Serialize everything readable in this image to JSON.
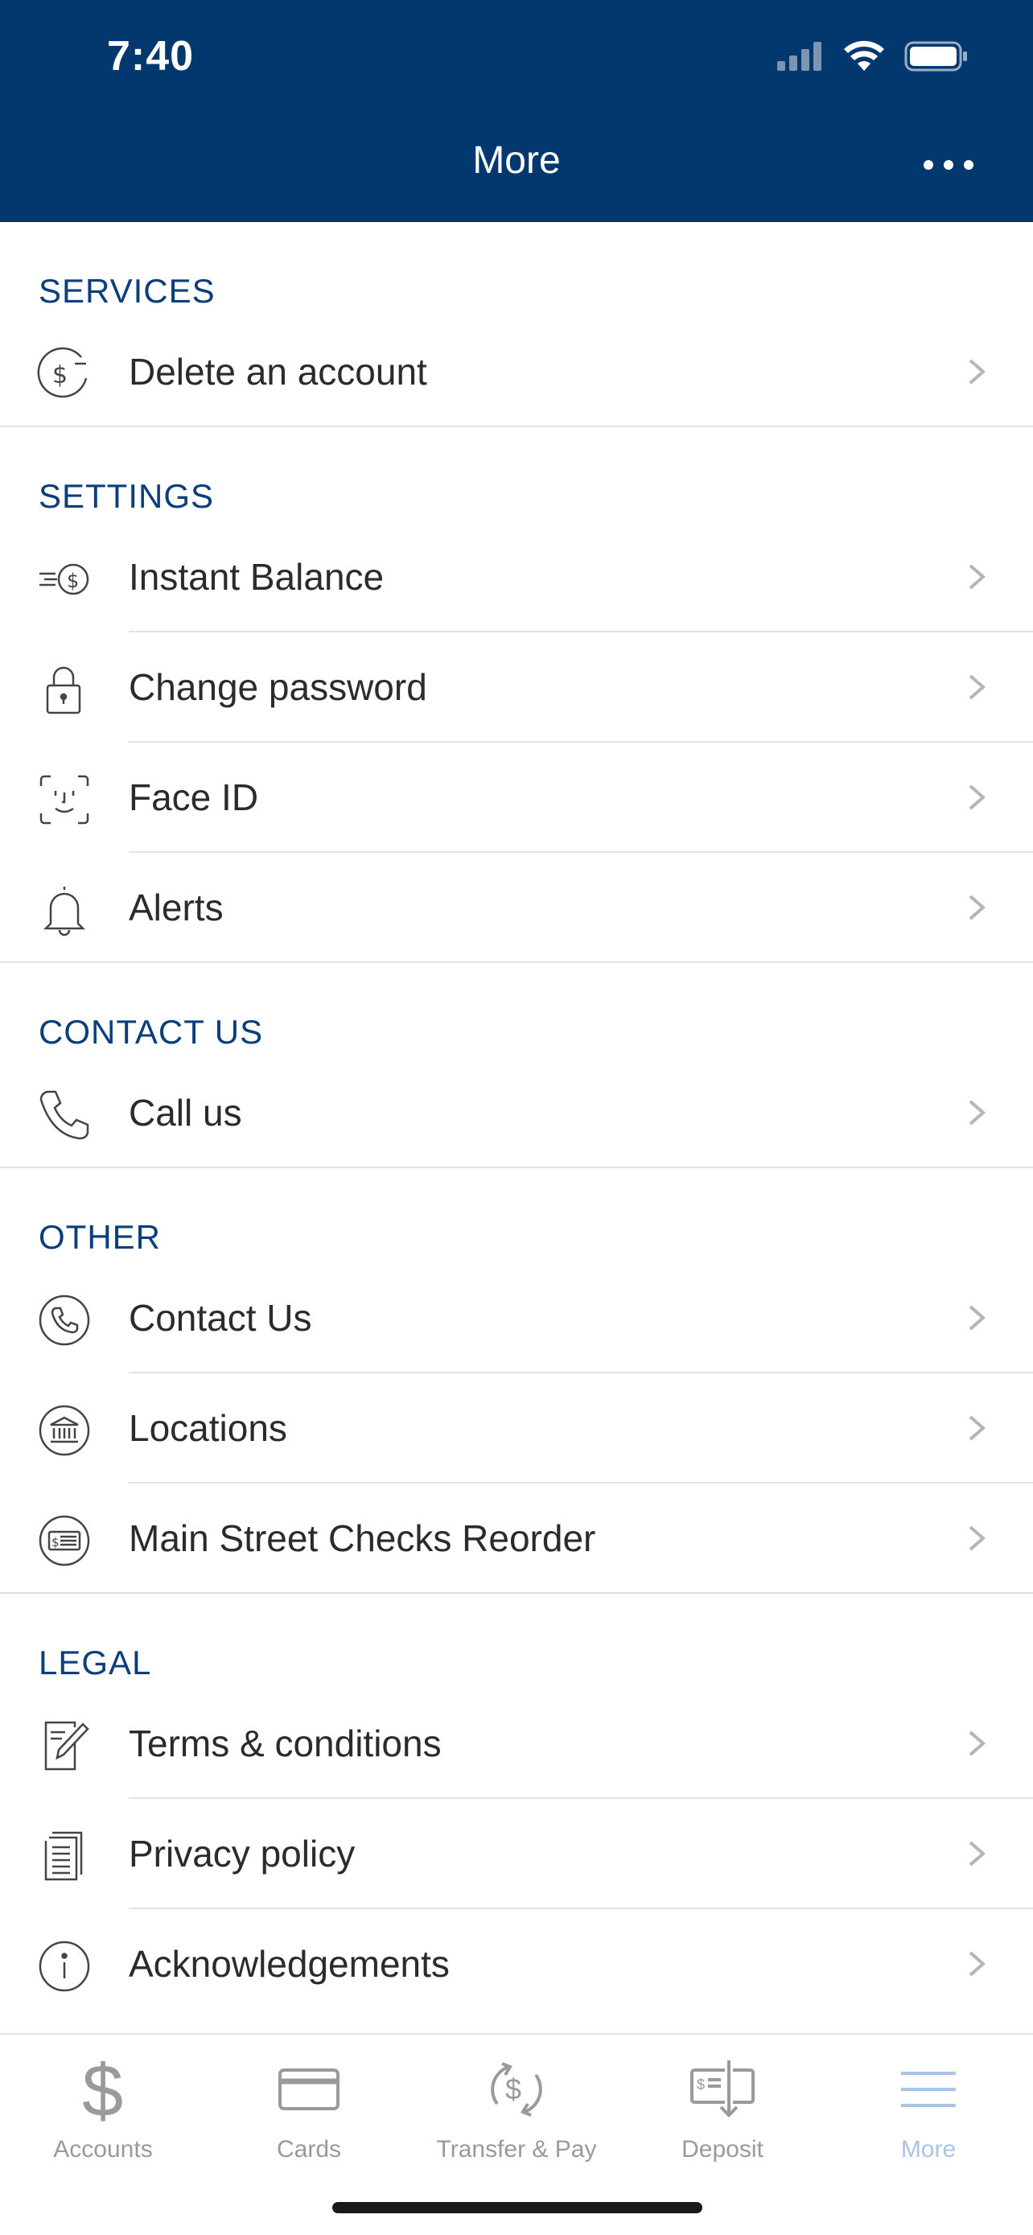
{
  "status": {
    "time": "7:40"
  },
  "header": {
    "title": "More",
    "more_icon": "more-dots-icon"
  },
  "sections": [
    {
      "title": "SERVICES",
      "items": [
        {
          "label": "Delete an account",
          "icon": "dollar-minus-icon"
        }
      ]
    },
    {
      "title": "SETTINGS",
      "items": [
        {
          "label": "Instant Balance",
          "icon": "instant-balance-icon"
        },
        {
          "label": "Change password",
          "icon": "lock-icon"
        },
        {
          "label": "Face ID",
          "icon": "face-id-icon"
        },
        {
          "label": "Alerts",
          "icon": "bell-icon"
        }
      ]
    },
    {
      "title": "CONTACT US",
      "items": [
        {
          "label": "Call us",
          "icon": "phone-icon"
        }
      ]
    },
    {
      "title": "OTHER",
      "items": [
        {
          "label": "Contact Us",
          "icon": "phone-circle-icon"
        },
        {
          "label": "Locations",
          "icon": "bank-icon"
        },
        {
          "label": "Main Street Checks Reorder",
          "icon": "check-icon"
        }
      ]
    },
    {
      "title": "LEGAL",
      "items": [
        {
          "label": "Terms & conditions",
          "icon": "document-pen-icon"
        },
        {
          "label": "Privacy policy",
          "icon": "document-icon"
        },
        {
          "label": "Acknowledgements",
          "icon": "info-icon"
        }
      ]
    }
  ],
  "tabbar": {
    "tabs": [
      {
        "label": "Accounts",
        "icon": "dollar-icon"
      },
      {
        "label": "Cards",
        "icon": "card-icon"
      },
      {
        "label": "Transfer & Pay",
        "icon": "transfer-icon"
      },
      {
        "label": "Deposit",
        "icon": "deposit-icon"
      },
      {
        "label": "More",
        "icon": "menu-icon",
        "active": true
      }
    ]
  },
  "colors": {
    "header_bg": "#02386e",
    "section_title": "#0b3e7a",
    "active_tab": "#a9c4e6",
    "inactive_tab": "#9a9a9a"
  }
}
